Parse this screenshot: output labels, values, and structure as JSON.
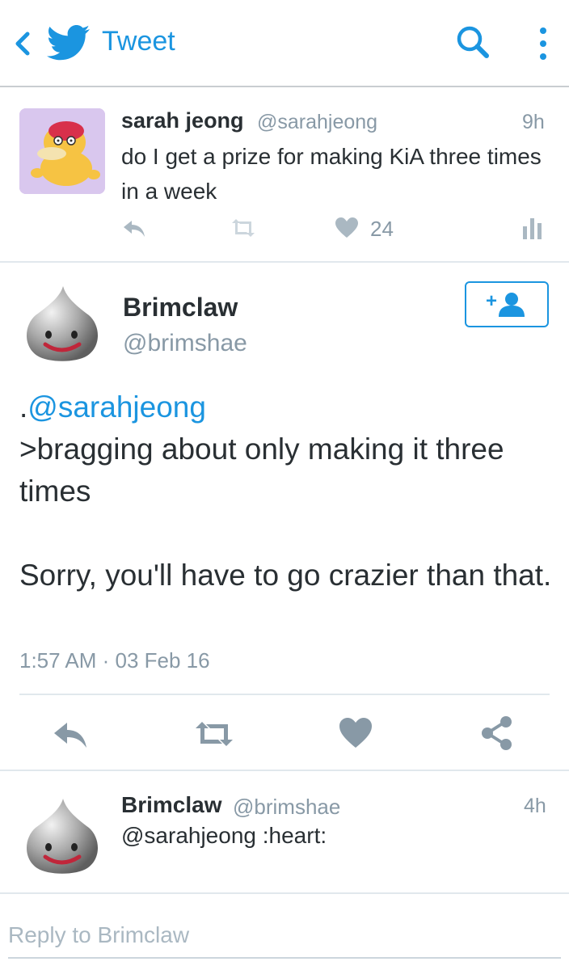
{
  "header": {
    "title": "Tweet",
    "accent": "#1b95e0"
  },
  "replied_tweet": {
    "name": "sarah jeong",
    "handle": "@sarahjeong",
    "time": "9h",
    "text": "do I get a prize for making KiA three times in a week",
    "like_count": "24"
  },
  "main_tweet": {
    "name": "Brimclaw",
    "handle": "@brimshae",
    "mention": "@sarahjeong",
    "mention_prefix": ".",
    "body": ">bragging about only making it three times\n\nSorry, you'll have to go crazier than that.",
    "timestamp": "1:57 AM · 03 Feb 16"
  },
  "reply_tweet": {
    "name": "Brimclaw",
    "handle": "@brimshae",
    "time": "4h",
    "text": "@sarahjeong :heart:"
  },
  "composer": {
    "placeholder": "Reply to Brimclaw"
  },
  "icons": {
    "back": "chevron-left-icon",
    "logo": "twitter-bird-icon",
    "search": "search-icon",
    "more": "more-vertical-icon",
    "reply": "reply-icon",
    "retweet": "retweet-icon",
    "like": "heart-icon",
    "stats": "stats-icon",
    "share": "share-icon",
    "follow": "add-user-icon"
  }
}
